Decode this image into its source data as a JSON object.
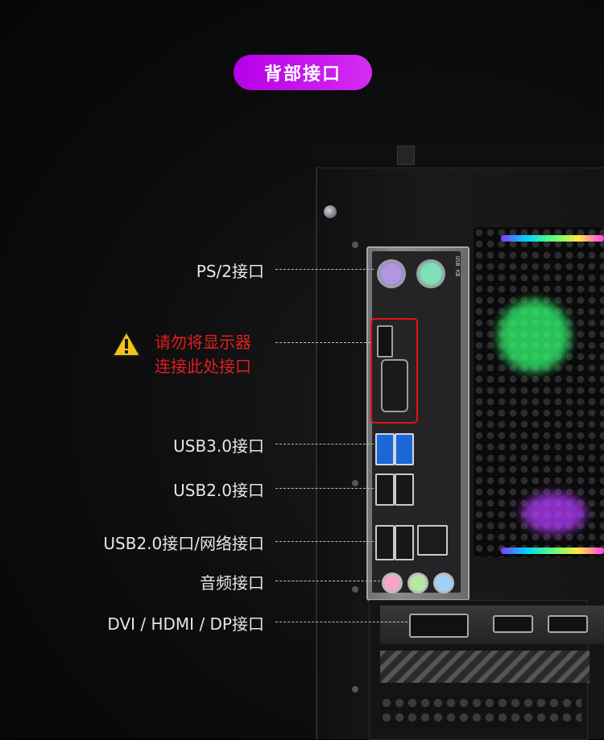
{
  "header": {
    "title": "背部接口"
  },
  "labels": {
    "ps2": "PS/2接口",
    "warning_line1": "请勿将显示器",
    "warning_line2": "连接此处接口",
    "usb30": "USB3.0接口",
    "usb20": "USB2.0接口",
    "usb20_lan": "USB2.0接口/网络接口",
    "audio": "音频接口",
    "video": "DVI / HDMI / DP接口"
  },
  "colors": {
    "title_pill": "#c21bee",
    "warning_text": "#e21d1d",
    "label_text": "#e6e6e6",
    "warning_icon": "#f2c31b"
  }
}
